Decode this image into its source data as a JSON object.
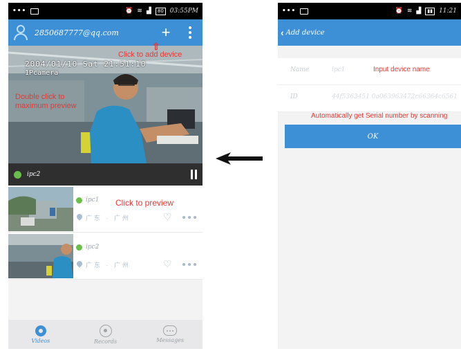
{
  "left_screen": {
    "statusbar": {
      "dots": "•••",
      "time": "03:55PM",
      "battery": "80"
    },
    "header": {
      "account": "2850687777@qq.com"
    },
    "preview": {
      "osd_datetime": "2004/01/10 Sat 21:51:10",
      "osd_camera": "1Pcamera"
    },
    "control_bar": {
      "camera_name": "ipc2"
    },
    "cameras": [
      {
        "name": "ipc1",
        "location": "广东 · 广州"
      },
      {
        "name": "ipc2",
        "location": "广东 · 广州"
      }
    ],
    "tabs": [
      {
        "label": "Videos",
        "icon": "videos-icon"
      },
      {
        "label": "Records",
        "icon": "records-icon"
      },
      {
        "label": "Messages",
        "icon": "messages-icon"
      }
    ]
  },
  "annotations": {
    "add_device": "Click to add device",
    "double_click": "Double click to maximum preview",
    "click_preview": "Click to preview",
    "input_name": "Input device name",
    "serial_scan": "Automatically get Serial number by scanning"
  },
  "right_screen": {
    "statusbar": {
      "dots": "•••",
      "time": "11:21"
    },
    "header": {
      "back": "‹",
      "title": "Add device"
    },
    "form": {
      "name_label": "Name",
      "name_value": "ipc1",
      "id_label": "ID",
      "id_value": "44f5363451 0a063963472c66364c6561"
    },
    "ok_label": "OK"
  },
  "colors": {
    "accent": "#3d8fd6",
    "annotation": "#e53935",
    "online": "#6abf4b"
  }
}
